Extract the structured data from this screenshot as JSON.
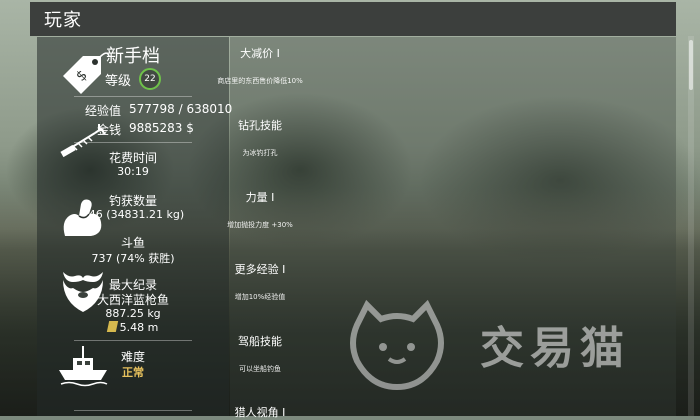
{
  "header": {
    "title": "玩家"
  },
  "player": {
    "save_name": "新手档",
    "level_label": "等级",
    "level_value": "22",
    "xp_label": "经验值",
    "xp_value": "577798 / 638010",
    "money_label": "金钱",
    "money_value": "9885283 $",
    "time_label": "花费时间",
    "time_value": "30:19",
    "catch_label": "钓获数量",
    "catch_value": "546 (34831.21 kg)",
    "fight_label": "斗鱼",
    "fight_value": "737 (74% 获胜)",
    "record_label": "最大纪录",
    "record_fish": "大西洋蓝枪鱼",
    "record_weight": "887.25 kg",
    "record_depth": "5.48 m",
    "difficulty_label": "难度",
    "difficulty_value": "正常"
  },
  "skills": [
    {
      "name": "大减价 I",
      "desc": "商店里的东西售价降低10%",
      "icon": "price-tag-icon"
    },
    {
      "name": "钻孔技能",
      "desc": "为冰钓打孔",
      "icon": "ice-drill-icon"
    },
    {
      "name": "力量 I",
      "desc": "增加抛投力度 +30%",
      "icon": "strength-arm-icon"
    },
    {
      "name": "更多经验 I",
      "desc": "增加10%经验值",
      "icon": "beard-icon"
    },
    {
      "name": "驾船技能",
      "desc": "可以坐船钓鱼",
      "icon": "boat-icon"
    },
    {
      "name": "猎人视角 I",
      "desc": "",
      "icon": "hunter-icon"
    }
  ],
  "watermark": {
    "text": "交易猫"
  },
  "colors": {
    "accent": "#e7c15d",
    "level_ring": "#6fc24a",
    "header_bg": "#3c3f3d"
  }
}
